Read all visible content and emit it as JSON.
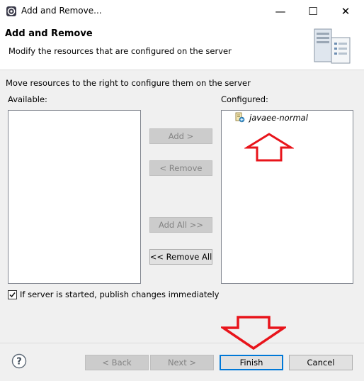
{
  "window": {
    "title": "Add and Remove...",
    "icon": "eclipse-gear-icon",
    "controls": {
      "minimize": "—",
      "maximize": "☐",
      "close": "✕"
    }
  },
  "banner": {
    "title": "Add and Remove",
    "description": "Modify the resources that are configured on the server",
    "icon": "server-icon"
  },
  "instruction": "Move resources to the right to configure them on the server",
  "available": {
    "label": "Available:",
    "items": []
  },
  "configured": {
    "label": "Configured:",
    "items": [
      {
        "label": "javaee-normal",
        "icon": "web-module-icon"
      }
    ]
  },
  "buttons": {
    "add": "Add >",
    "remove": "< Remove",
    "add_all": "Add All >>",
    "remove_all": "<< Remove All",
    "back": "< Back",
    "next": "Next >",
    "finish": "Finish",
    "cancel": "Cancel"
  },
  "publish_option": {
    "label": "If server is started, publish changes immediately",
    "checked": true
  },
  "annotation_color": "#e8141b"
}
